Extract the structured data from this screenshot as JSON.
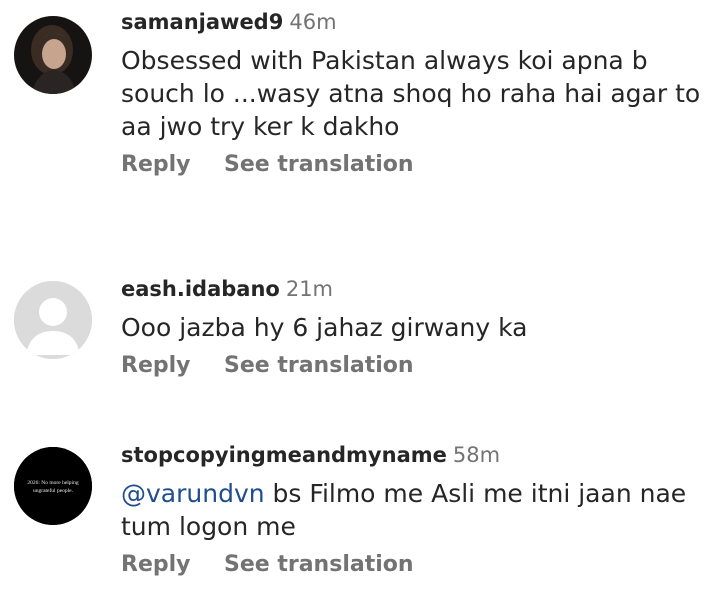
{
  "comments": [
    {
      "username": "samanjawed9",
      "time": "46m",
      "mention": "",
      "text": "Obsessed with Pakistan always koi apna b souch lo ...wasy atna shoq ho raha hai agar to aa jwo try ker k dakho",
      "reply_label": "Reply",
      "translate_label": "See translation",
      "avatar": "photo"
    },
    {
      "username": "eash.idabano",
      "time": "21m",
      "mention": "",
      "text": "Ooo jazba hy 6 jahaz girwany ka",
      "reply_label": "Reply",
      "translate_label": "See translation",
      "avatar": "default-person-icon"
    },
    {
      "username": "stopcopyingmeandmyname",
      "time": "58m",
      "mention": "@varundvn",
      "text": " bs Filmo me Asli me itni jaan nae tum logon me",
      "reply_label": "Reply",
      "translate_label": "See translation",
      "avatar": "text-image",
      "avatar_text": [
        "2026: No more helping",
        "ungrateful people."
      ]
    }
  ],
  "colors": {
    "username": "#262626",
    "secondary": "#737373",
    "mention": "#1f4d8f",
    "default_avatar_bg": "#dbdbdb"
  }
}
